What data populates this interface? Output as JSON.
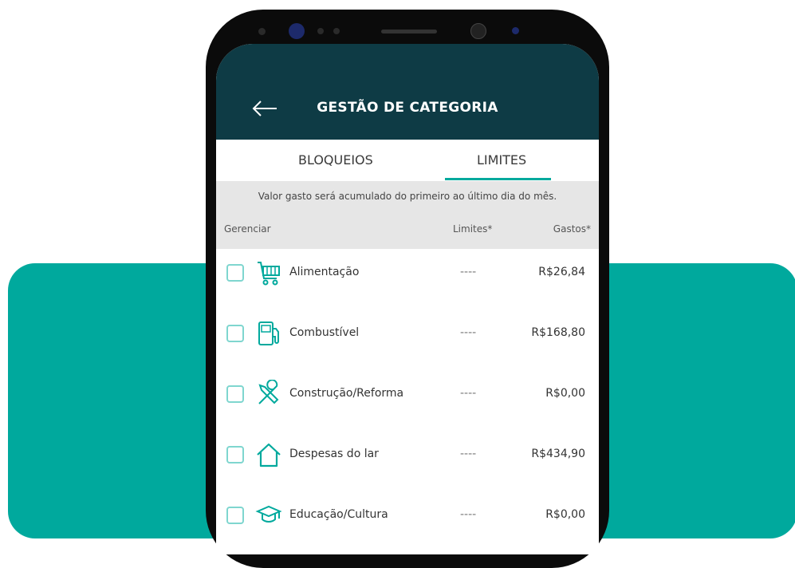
{
  "header": {
    "title": "GESTÃO DE CATEGORIA"
  },
  "tabs": [
    {
      "label": "BLOQUEIOS",
      "active": false
    },
    {
      "label": "LIMITES",
      "active": true
    }
  ],
  "info_text": "Valor gasto será acumulado do primeiro ao último dia do mês.",
  "columns": {
    "manage": "Gerenciar",
    "limits": "Limites*",
    "spent": "Gastos*"
  },
  "categories": [
    {
      "icon": "cart-icon",
      "label": "Alimentação",
      "limit": "----",
      "spent": "R$26,84"
    },
    {
      "icon": "fuel-pump-icon",
      "label": "Combustível",
      "limit": "----",
      "spent": "R$168,80"
    },
    {
      "icon": "tools-icon",
      "label": "Construção/Reforma",
      "limit": "----",
      "spent": "R$0,00"
    },
    {
      "icon": "house-icon",
      "label": "Despesas do lar",
      "limit": "----",
      "spent": "R$434,90"
    },
    {
      "icon": "graduation-cap-icon",
      "label": "Educação/Cultura",
      "limit": "----",
      "spent": "R$0,00"
    }
  ],
  "colors": {
    "accent": "#00a99d",
    "header": "#0e3b45"
  }
}
